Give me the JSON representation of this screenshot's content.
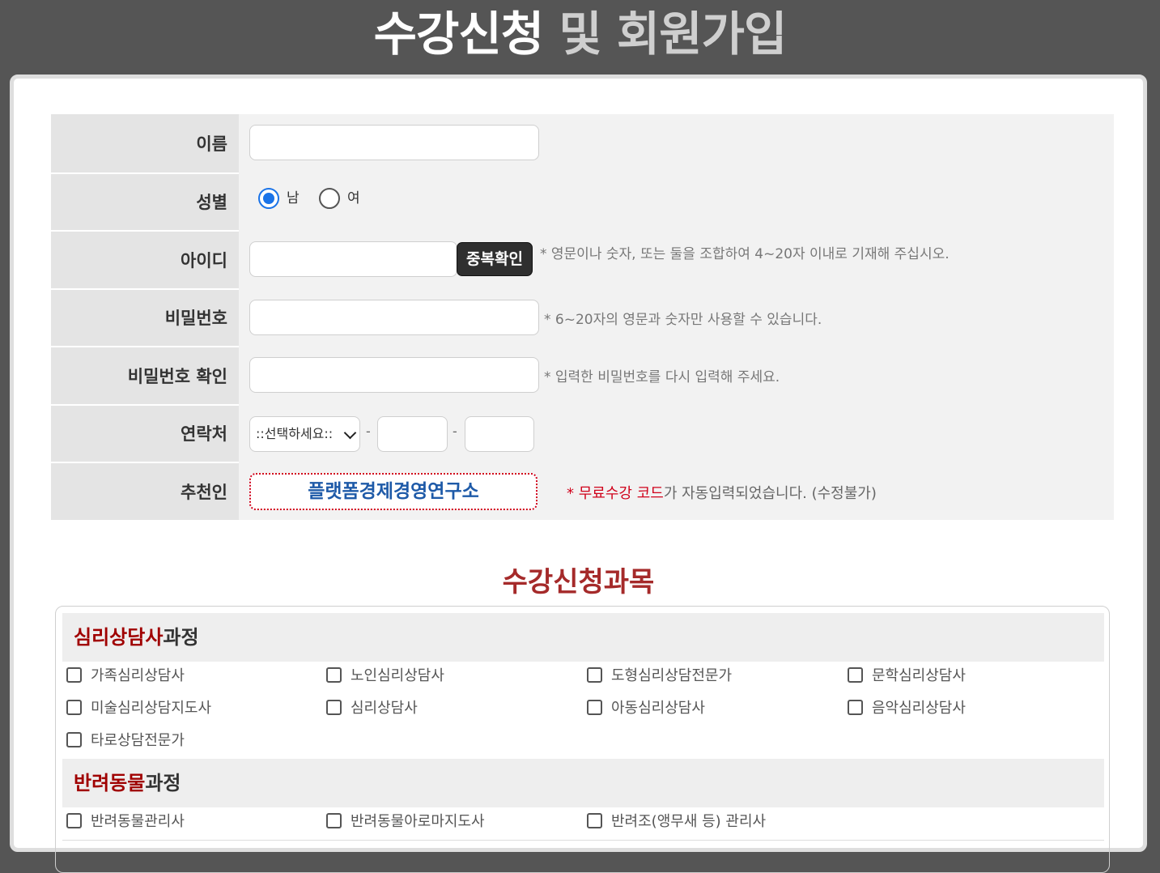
{
  "header": {
    "title_part1": "수강신청",
    "title_part2": "및 회원가입"
  },
  "form": {
    "name_label": "이름",
    "gender_label": "성별",
    "gender_options": [
      "남",
      "여"
    ],
    "gender_selected": "남",
    "id_label": "아이디",
    "dup_check_button": "중복확인",
    "id_hint": "* 영문이나 숫자, 또는 둘을 조합하여 4~20자 이내로 기재해 주십시오.",
    "password_label": "비밀번호",
    "password_hint": "* 6~20자의 영문과 숫자만 사용할 수 있습니다.",
    "password_confirm_label": "비밀번호 확인",
    "password_confirm_hint": "* 입력한 비밀번호를 다시 입력해 주세요.",
    "contact_label": "연락처",
    "contact_select": "::선택하세요::",
    "contact_dash": "-",
    "referrer_label": "추천인",
    "referrer_value": "플랫폼경제경영연구소",
    "referrer_note_star": "*",
    "referrer_note_red": "무료수강 코드",
    "referrer_note_rest": "가 자동입력되었습니다. (수정불가)"
  },
  "courses": {
    "section_title": "수강신청과목",
    "categories": [
      {
        "highlight": "심리상담사",
        "suffix": "과정",
        "items": [
          "가족심리상담사",
          "노인심리상담사",
          "도형심리상담전문가",
          "문학심리상담사",
          "미술심리상담지도사",
          "심리상담사",
          "아동심리상담사",
          "음악심리상담사",
          "타로상담전문가"
        ]
      },
      {
        "highlight": "반려동물",
        "suffix": "과정",
        "items": [
          "반려동물관리사",
          "반려동물아로마지도사",
          "반려조(앵무새 등) 관리사"
        ]
      }
    ]
  },
  "colors": {
    "background": "#555555",
    "accent_blue": "#1e5aa8",
    "accent_red": "#d0021b",
    "section_title": "#a52a2a",
    "category_highlight": "#a00000"
  }
}
